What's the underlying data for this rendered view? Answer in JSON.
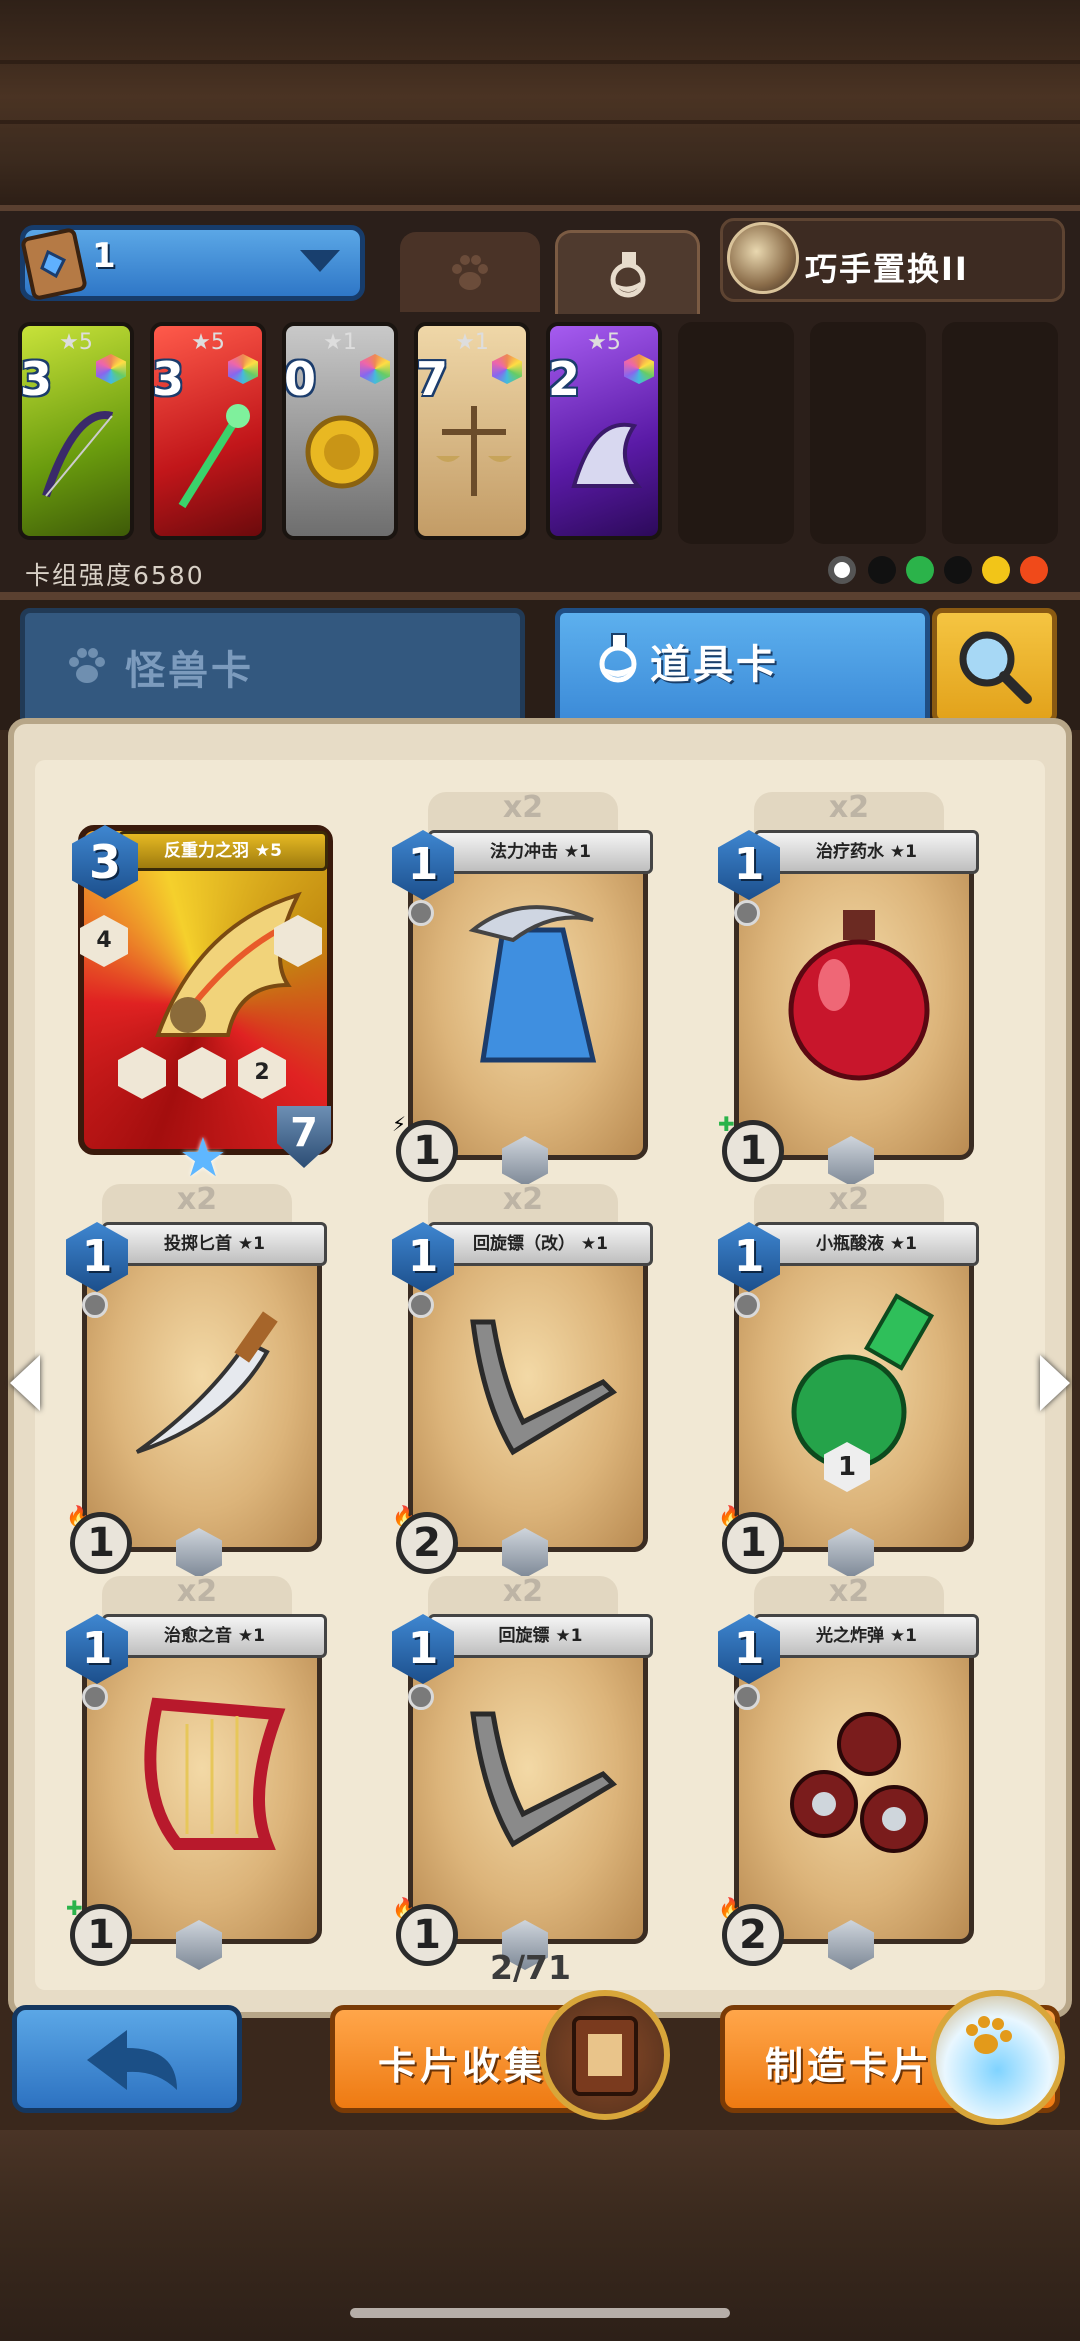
{
  "deck": {
    "number": "1",
    "hero_name": "巧手置换II",
    "power_label": "卡组强度6580",
    "cards": [
      {
        "cost": "3",
        "stars": "★5",
        "color": "#8fbf1c"
      },
      {
        "cost": "3",
        "stars": "★5",
        "color": "#c9211f"
      },
      {
        "cost": "0",
        "stars": "★1",
        "color": "#9a9a9a"
      },
      {
        "cost": "7",
        "stars": "★1",
        "color": "#c9a46c"
      },
      {
        "cost": "2",
        "stars": "★5",
        "color": "#7a2fc9"
      }
    ],
    "empty_slots": 3
  },
  "tabs": {
    "monster": "怪兽卡",
    "item": "道具卡"
  },
  "cards": [
    {
      "name": "反重力之羽 ★5",
      "cost": "3",
      "qty": "",
      "rare": true,
      "badge1": "4",
      "badge2": "2",
      "armor": "7"
    },
    {
      "name": "法力冲击 ★1",
      "cost": "1",
      "qty": "x2",
      "rank": "1",
      "fx": "⚡"
    },
    {
      "name": "治疗药水 ★1",
      "cost": "1",
      "qty": "x2",
      "rank": "1",
      "fx": "✚"
    },
    {
      "name": "投掷匕首 ★1",
      "cost": "1",
      "qty": "x2",
      "rank": "1",
      "fx": "🔥"
    },
    {
      "name": "回旋镖（改） ★1",
      "cost": "1",
      "qty": "x2",
      "rank": "2",
      "fx": "🔥"
    },
    {
      "name": "小瓶酸液 ★1",
      "cost": "1",
      "qty": "x2",
      "rank": "1",
      "fx": "🔥",
      "extra": "1"
    },
    {
      "name": "治愈之音 ★1",
      "cost": "1",
      "qty": "x2",
      "rank": "1",
      "fx": "✚"
    },
    {
      "name": "回旋镖 ★1",
      "cost": "1",
      "qty": "x2",
      "rank": "1",
      "fx": "🔥"
    },
    {
      "name": "光之炸弹 ★1",
      "cost": "1",
      "qty": "x2",
      "rank": "2",
      "fx": "🔥"
    }
  ],
  "page_counter": "2/71",
  "buttons": {
    "collect": "卡片收集",
    "craft": "制造卡片"
  },
  "colors": {
    "primary_blue": "#3c8bd8",
    "orange": "#ee7a12",
    "parchment": "#f1e8d4"
  }
}
